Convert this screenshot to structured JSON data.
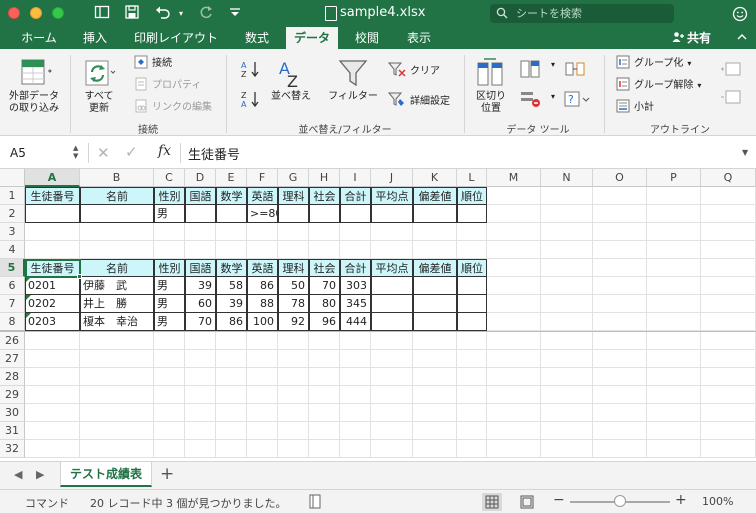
{
  "window": {
    "title": "sample4.xlsx",
    "search_placeholder": "シートを検索",
    "colors": {
      "brand": "#217346",
      "header_fill": "#ccf6fa"
    }
  },
  "ribbon_tabs": [
    {
      "label": "ホーム",
      "active": false
    },
    {
      "label": "挿入",
      "active": false
    },
    {
      "label": "印刷レイアウト",
      "active": false
    },
    {
      "label": "数式",
      "active": false
    },
    {
      "label": "データ",
      "active": true
    },
    {
      "label": "校閲",
      "active": false
    },
    {
      "label": "表示",
      "active": false
    }
  ],
  "share_label": "共有",
  "ribbon": {
    "external_data": "外部データ\nの取り込み",
    "refresh_all": "すべて\n更新",
    "connections": "接続",
    "properties": "プロパティ",
    "edit_links": "リンクの編集",
    "group_connections": "接続",
    "sort_label": "並べ替え",
    "filter_label": "フィルター",
    "clear_label": "クリア",
    "advanced_label": "詳細設定",
    "group_sort_filter": "並べ替え/フィルター",
    "text_to_columns": "区切り\n位置",
    "group_data_tools": "データ ツール",
    "group_label": "グループ化",
    "ungroup_label": "グループ解除",
    "subtotal_label": "小計",
    "group_outline": "アウトライン"
  },
  "formula_bar": {
    "name_box": "A5",
    "fx": "fx",
    "content": "生徒番号"
  },
  "columns": [
    "A",
    "B",
    "C",
    "D",
    "E",
    "F",
    "G",
    "H",
    "I",
    "J",
    "K",
    "L",
    "M",
    "N",
    "O",
    "P",
    "Q"
  ],
  "rows_visible": [
    "1",
    "2",
    "3",
    "4",
    "5",
    "6",
    "7",
    "8",
    "26",
    "27",
    "28",
    "29",
    "30",
    "31",
    "32"
  ],
  "criteria_header": [
    "生徒番号",
    "名前",
    "性別",
    "国語",
    "数学",
    "英語",
    "理科",
    "社会",
    "合計",
    "平均点",
    "偏差値",
    "順位"
  ],
  "criteria_row2": {
    "gender": "男",
    "english": ">=80"
  },
  "table_header": [
    "生徒番号",
    "名前",
    "性別",
    "国語",
    "数学",
    "英語",
    "理科",
    "社会",
    "合計",
    "平均点",
    "偏差値",
    "順位"
  ],
  "table_rows": [
    {
      "id": "0201",
      "name": "伊藤　武",
      "gender": "男",
      "kokugo": "39",
      "sugaku": "58",
      "eigo": "86",
      "rika": "50",
      "shakai": "70",
      "total": "303"
    },
    {
      "id": "0202",
      "name": "井上　勝",
      "gender": "男",
      "kokugo": "60",
      "sugaku": "39",
      "eigo": "88",
      "rika": "78",
      "shakai": "80",
      "total": "345"
    },
    {
      "id": "0203",
      "name": "榎本　幸治",
      "gender": "男",
      "kokugo": "70",
      "sugaku": "86",
      "eigo": "100",
      "rika": "92",
      "shakai": "96",
      "total": "444"
    }
  ],
  "sheet_tab": "テスト成績表",
  "status": {
    "mode": "コマンド",
    "message": "20 レコード中 3 個が見つかりました。",
    "zoom": "100%",
    "zoom_level_percent": 100
  }
}
